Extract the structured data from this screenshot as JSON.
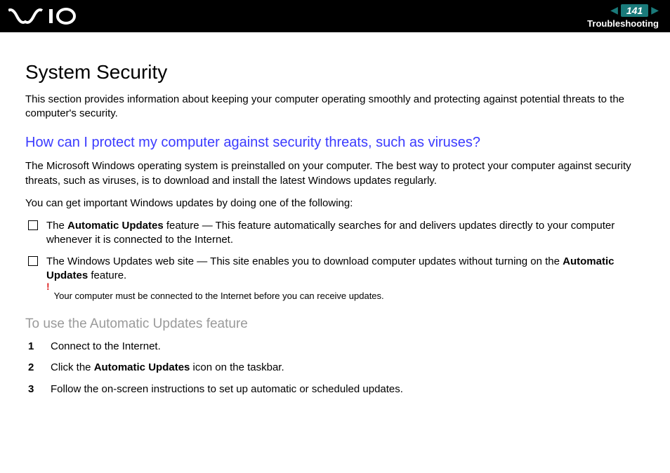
{
  "header": {
    "page_number": "141",
    "breadcrumb": "Troubleshooting"
  },
  "title": "System Security",
  "intro": "This section provides information about keeping your computer operating smoothly and protecting against potential threats to the computer's security.",
  "question": "How can I protect my computer against security threats, such as viruses?",
  "p1": "The Microsoft Windows operating system is preinstalled on your computer. The best way to protect your computer against security threats, such as viruses, is to download and install the latest Windows updates regularly.",
  "p2": "You can get important Windows updates by doing one of the following:",
  "bullets": [
    {
      "pre": "The ",
      "b1": "Automatic Updates",
      "post": " feature — This feature automatically searches for and delivers updates directly to your computer whenever it is connected to the Internet."
    },
    {
      "pre": "The Windows Updates web site — This site enables you to download computer updates without turning on the ",
      "b1": "Automatic Updates",
      "post": " feature."
    }
  ],
  "note_mark": "!",
  "note": "Your computer must be connected to the Internet before you can receive updates.",
  "h3": "To use the Automatic Updates feature",
  "steps": [
    {
      "n": "1",
      "pre": "Connect to the Internet.",
      "b1": "",
      "post": ""
    },
    {
      "n": "2",
      "pre": "Click the ",
      "b1": "Automatic Updates",
      "post": " icon on the taskbar."
    },
    {
      "n": "3",
      "pre": "Follow the on-screen instructions to set up automatic or scheduled updates.",
      "b1": "",
      "post": ""
    }
  ]
}
